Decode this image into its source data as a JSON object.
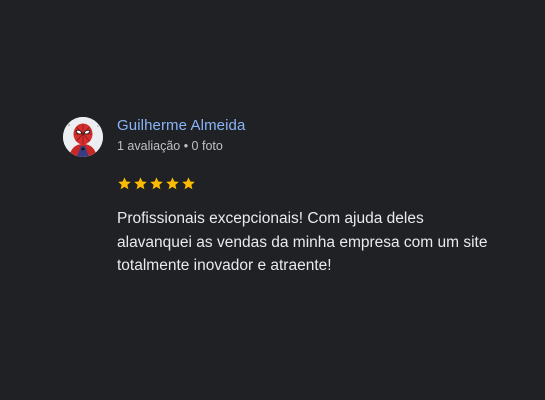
{
  "review": {
    "author_name": "Guilherme Almeida",
    "author_meta": "1 avaliação • 0 foto",
    "rating": 5,
    "rating_max": 5,
    "star_color": "#fbbc04",
    "text": "Profissionais excepcionais! Com ajuda deles alavanquei as vendas da minha empresa com um site totalmente inovador e atraente!"
  },
  "colors": {
    "background": "#202124",
    "author_link": "#8ab4f8",
    "meta_text": "#bdc1c6",
    "body_text": "#e8eaed"
  },
  "icons": {
    "avatar": "spider-man-avatar-icon",
    "star": "star-icon"
  }
}
